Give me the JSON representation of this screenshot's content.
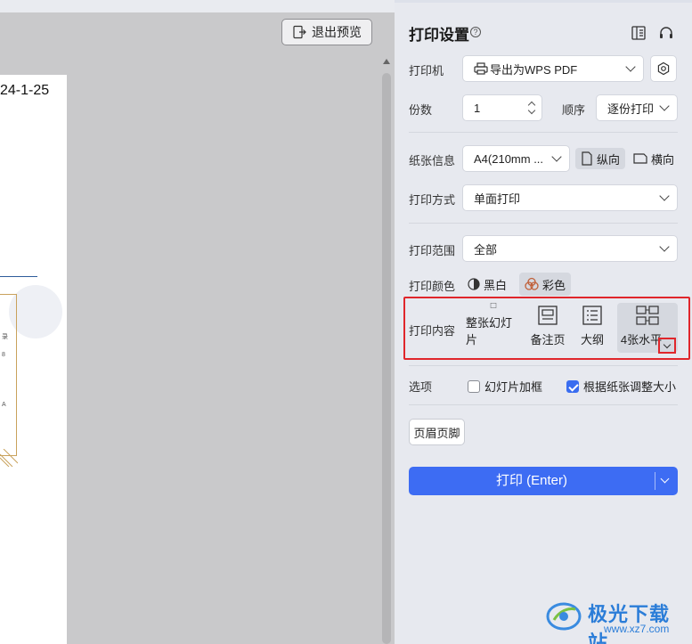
{
  "preview": {
    "exit_button_label": "退出预览",
    "page_date_text": "24-1-25",
    "side_chars": [
      "录",
      "8",
      "A"
    ]
  },
  "settings": {
    "title": "打印设置",
    "printer": {
      "label": "打印机",
      "value": "导出为WPS PDF"
    },
    "copies": {
      "label": "份数",
      "value": "1"
    },
    "order": {
      "label": "顺序",
      "value": "逐份打印"
    },
    "paper": {
      "label": "纸张信息",
      "value": "A4(210mm ...",
      "portrait": "纵向",
      "landscape": "横向"
    },
    "mode": {
      "label": "打印方式",
      "value": "单面打印"
    },
    "range": {
      "label": "打印范围",
      "value": "全部"
    },
    "color": {
      "label": "打印颜色",
      "bw": "黑白",
      "color": "彩色"
    },
    "content": {
      "label": "打印内容",
      "options": [
        "整张幻灯片",
        "备注页",
        "大纲",
        "4张水平"
      ]
    },
    "options": {
      "label": "选项",
      "frame": "幻灯片加框",
      "fit": "根据纸张调整大小",
      "frame_checked": false,
      "fit_checked": true
    },
    "header_footer_button": "页眉页脚",
    "print_button": "打印 (Enter)"
  },
  "watermark": {
    "text": "极光下载站",
    "url": "www.xz7.com"
  },
  "colors": {
    "accent": "#3d6cf3",
    "highlight": "#e0262b",
    "panel_bg": "#e7e9ef",
    "preview_bg": "#c9c9cb"
  }
}
